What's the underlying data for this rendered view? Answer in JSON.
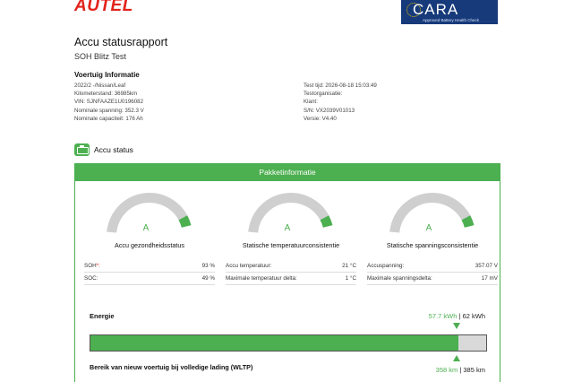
{
  "header": {
    "brand": "AUTEL",
    "cert_name": "CARA",
    "cert_sub": "Approved Battery Health Check"
  },
  "report": {
    "title": "Accu statusrapport",
    "subtitle": "SOH Blitz Test"
  },
  "vehicle_info": {
    "heading": "Voertuig Informatie",
    "left": [
      "2022/2 -/Nissan/Leaf",
      "Kilometerstand: 36985km",
      "VIN: SJNFAAZE1U0196082",
      "Nominale spanning: 352.3 V",
      "Nominale capaciteit: 176 Ah"
    ],
    "right": [
      "Test tijd: 2026-08-18 15:03:49",
      "Testorganisatie:",
      "Klant:",
      "S/N: VX2039V01013",
      "Versie: V4.40"
    ]
  },
  "accu_status": {
    "label": "Accu status",
    "icon": "battery-icon",
    "accent": "#4caf50"
  },
  "panel": {
    "heading": "Pakketinformatie",
    "gauges": [
      {
        "grade": "A",
        "level": 0.92,
        "title": "Accu gezondheidsstatus",
        "rows": [
          {
            "label": "SOH",
            "mark": "*:",
            "value": "93 %"
          },
          {
            "label": "SOC:",
            "mark": "",
            "value": "49 %"
          }
        ]
      },
      {
        "grade": "A",
        "level": 0.92,
        "title": "Statische temperatuurconsistentie",
        "rows": [
          {
            "label": "Accu temperatuur:",
            "mark": "",
            "value": "21 °C"
          },
          {
            "label": "Maximale temperatuur delta:",
            "mark": "",
            "value": "1 °C"
          }
        ]
      },
      {
        "grade": "A",
        "level": 0.92,
        "title": "Statische spanningsconsistentie",
        "rows": [
          {
            "label": "Accuspanning:",
            "mark": "",
            "value": "357.07 V"
          },
          {
            "label": "Maximale spanningsdelta:",
            "mark": "",
            "value": "17 mV"
          }
        ]
      }
    ],
    "energy": {
      "label": "Energie",
      "current": "57.7 kWh",
      "separator": " | ",
      "total": "62 kWh",
      "fraction": 0.93
    },
    "range": {
      "label": "Bereik van nieuw voertuig bij volledige lading (WLTP)",
      "current": "358 km",
      "separator": " | ",
      "total": "385 km"
    }
  }
}
